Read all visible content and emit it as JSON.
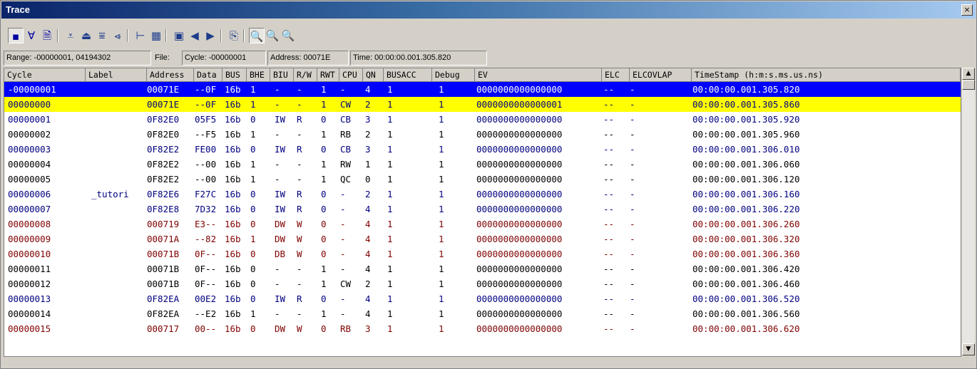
{
  "window": {
    "title": "Trace",
    "close_glyph": "×"
  },
  "toolbar": {
    "buttons": [
      {
        "icon": "record-icon",
        "glyph": "▪",
        "active": true
      },
      {
        "icon": "filter-icon",
        "glyph": "∀",
        "active": false
      },
      {
        "icon": "document-icon",
        "glyph": "🗎",
        "active": false
      },
      {
        "icon": "move-down-icon",
        "glyph": "⩡",
        "active": false
      },
      {
        "icon": "move-up-icon",
        "glyph": "⏏",
        "active": false
      },
      {
        "icon": "go-bottom-icon",
        "glyph": "⩸",
        "active": false
      },
      {
        "icon": "go-top-icon",
        "glyph": "⩹",
        "active": false
      },
      {
        "icon": "tree-icon",
        "glyph": "⊢",
        "active": false
      },
      {
        "icon": "column-icon",
        "glyph": "▦",
        "active": false
      },
      {
        "icon": "frame-icon",
        "glyph": "▣",
        "active": false
      },
      {
        "icon": "prev-icon",
        "glyph": "◀",
        "active": false
      },
      {
        "icon": "next-icon",
        "glyph": "▶",
        "active": false
      },
      {
        "icon": "properties-icon",
        "glyph": "⎘",
        "active": false
      },
      {
        "icon": "zoom-icon",
        "glyph": "🔍",
        "active": true
      },
      {
        "icon": "zoom-in-icon",
        "glyph": "🔍",
        "active": false
      },
      {
        "icon": "zoom-out-icon",
        "glyph": "🔍",
        "active": false
      }
    ]
  },
  "status": {
    "range": "Range: -00000001, 04194302",
    "file_label": "File:",
    "cycle": "Cycle: -00000001",
    "address": "Address: 00071E",
    "time": "Time: 00:00:00.001.305.820"
  },
  "table": {
    "columns": [
      "Cycle",
      "Label",
      "Address",
      "Data",
      "BUS",
      "BHE",
      "BIU",
      "R/W",
      "RWT",
      "CPU",
      "QN",
      "BUSACC",
      "Debug",
      "EV",
      "ELC",
      "ELCOVLAP",
      "TimeStamp (h:m:s.ms.us.ns)"
    ],
    "rows": [
      {
        "cells": [
          "-00000001",
          "",
          "00071E",
          "--0F",
          "16b",
          "1",
          "-",
          "-",
          "1",
          "-",
          "4",
          "1",
          "1",
          "0000000000000000",
          "--",
          "-",
          "00:00:00.001.305.820"
        ],
        "color": "#ffffff",
        "bg": "#0000ff"
      },
      {
        "cells": [
          "00000000",
          "",
          "00071E",
          "--0F",
          "16b",
          "1",
          "-",
          "-",
          "1",
          "CW",
          "2",
          "1",
          "1",
          "0000000000000001",
          "--",
          "-",
          "00:00:00.001.305.860"
        ],
        "color": "#000080",
        "bg": "#ffff00"
      },
      {
        "cells": [
          "00000001",
          "",
          "0F82E0",
          "05F5",
          "16b",
          "0",
          "IW",
          "R",
          "0",
          "CB",
          "3",
          "1",
          "1",
          "0000000000000000",
          "--",
          "-",
          "00:00:00.001.305.920"
        ],
        "color": "#000080",
        "bg": ""
      },
      {
        "cells": [
          "00000002",
          "",
          "0F82E0",
          "--F5",
          "16b",
          "1",
          "-",
          "-",
          "1",
          "RB",
          "2",
          "1",
          "1",
          "0000000000000000",
          "--",
          "-",
          "00:00:00.001.305.960"
        ],
        "color": "#000000",
        "bg": ""
      },
      {
        "cells": [
          "00000003",
          "",
          "0F82E2",
          "FE00",
          "16b",
          "0",
          "IW",
          "R",
          "0",
          "CB",
          "3",
          "1",
          "1",
          "0000000000000000",
          "--",
          "-",
          "00:00:00.001.306.010"
        ],
        "color": "#000080",
        "bg": ""
      },
      {
        "cells": [
          "00000004",
          "",
          "0F82E2",
          "--00",
          "16b",
          "1",
          "-",
          "-",
          "1",
          "RW",
          "1",
          "1",
          "1",
          "0000000000000000",
          "--",
          "-",
          "00:00:00.001.306.060"
        ],
        "color": "#000000",
        "bg": ""
      },
      {
        "cells": [
          "00000005",
          "",
          "0F82E2",
          "--00",
          "16b",
          "1",
          "-",
          "-",
          "1",
          "QC",
          "0",
          "1",
          "1",
          "0000000000000000",
          "--",
          "-",
          "00:00:00.001.306.120"
        ],
        "color": "#000000",
        "bg": ""
      },
      {
        "cells": [
          "00000006",
          "_tutori",
          "0F82E6",
          "F27C",
          "16b",
          "0",
          "IW",
          "R",
          "0",
          "-",
          "2",
          "1",
          "1",
          "0000000000000000",
          "--",
          "-",
          "00:00:00.001.306.160"
        ],
        "color": "#000080",
        "bg": ""
      },
      {
        "cells": [
          "00000007",
          "",
          "0F82E8",
          "7D32",
          "16b",
          "0",
          "IW",
          "R",
          "0",
          "-",
          "4",
          "1",
          "1",
          "0000000000000000",
          "--",
          "-",
          "00:00:00.001.306.220"
        ],
        "color": "#000080",
        "bg": ""
      },
      {
        "cells": [
          "00000008",
          "",
          "000719",
          "E3--",
          "16b",
          "0",
          "DW",
          "W",
          "0",
          "-",
          "4",
          "1",
          "1",
          "0000000000000000",
          "--",
          "-",
          "00:00:00.001.306.260"
        ],
        "color": "#800000",
        "bg": ""
      },
      {
        "cells": [
          "00000009",
          "",
          "00071A",
          "--82",
          "16b",
          "1",
          "DW",
          "W",
          "0",
          "-",
          "4",
          "1",
          "1",
          "0000000000000000",
          "--",
          "-",
          "00:00:00.001.306.320"
        ],
        "color": "#800000",
        "bg": ""
      },
      {
        "cells": [
          "00000010",
          "",
          "00071B",
          "0F--",
          "16b",
          "0",
          "DB",
          "W",
          "0",
          "-",
          "4",
          "1",
          "1",
          "0000000000000000",
          "--",
          "-",
          "00:00:00.001.306.360"
        ],
        "color": "#800000",
        "bg": ""
      },
      {
        "cells": [
          "00000011",
          "",
          "00071B",
          "0F--",
          "16b",
          "0",
          "-",
          "-",
          "1",
          "-",
          "4",
          "1",
          "1",
          "0000000000000000",
          "--",
          "-",
          "00:00:00.001.306.420"
        ],
        "color": "#000000",
        "bg": ""
      },
      {
        "cells": [
          "00000012",
          "",
          "00071B",
          "0F--",
          "16b",
          "0",
          "-",
          "-",
          "1",
          "CW",
          "2",
          "1",
          "1",
          "0000000000000000",
          "--",
          "-",
          "00:00:00.001.306.460"
        ],
        "color": "#000000",
        "bg": ""
      },
      {
        "cells": [
          "00000013",
          "",
          "0F82EA",
          "00E2",
          "16b",
          "0",
          "IW",
          "R",
          "0",
          "-",
          "4",
          "1",
          "1",
          "0000000000000000",
          "--",
          "-",
          "00:00:00.001.306.520"
        ],
        "color": "#000080",
        "bg": ""
      },
      {
        "cells": [
          "00000014",
          "",
          "0F82EA",
          "--E2",
          "16b",
          "1",
          "-",
          "-",
          "1",
          "-",
          "4",
          "1",
          "1",
          "0000000000000000",
          "--",
          "-",
          "00:00:00.001.306.560"
        ],
        "color": "#000000",
        "bg": ""
      },
      {
        "cells": [
          "00000015",
          "",
          "000717",
          "00--",
          "16b",
          "0",
          "DW",
          "W",
          "0",
          "RB",
          "3",
          "1",
          "1",
          "0000000000000000",
          "--",
          "-",
          "00:00:00.001.306.620"
        ],
        "color": "#800000",
        "bg": ""
      }
    ]
  },
  "scrollbar": {
    "up_glyph": "▲",
    "down_glyph": "▼"
  }
}
